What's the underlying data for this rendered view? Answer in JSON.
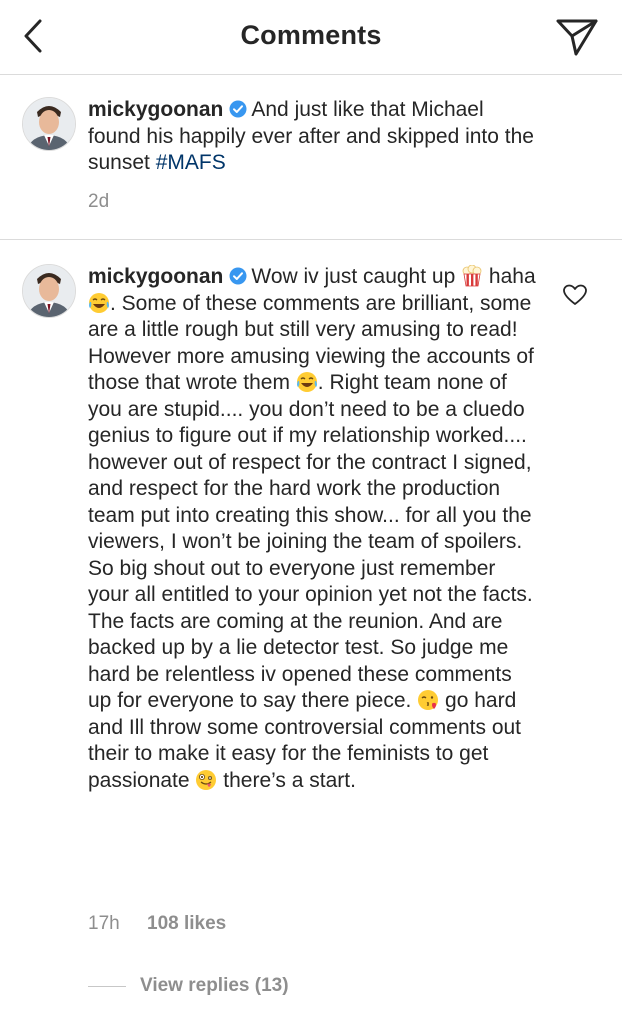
{
  "header": {
    "title": "Comments",
    "back_icon": "chevron-left-icon",
    "share_icon": "paper-plane-icon"
  },
  "caption": {
    "username": "mickygoonan",
    "text_before_tag": "And just like that Michael found his happily ever after and skipped into the sunset ",
    "hashtag": "#MAFS",
    "time": "2d"
  },
  "comment": {
    "username": "mickygoonan",
    "part1": "Wow iv just caught up ",
    "part2": " haha ",
    "part3": ". Some of these comments are brilliant, some are a little rough but still very amusing to read! However more amusing viewing the accounts of those that wrote them ",
    "part4": ". Right team none of you are stupid.... you don’t need to be a cluedo genius to figure out if my relationship worked.... however out of respect for the contract I signed, and respect for the hard work the production team put into creating this show... for all you the viewers, I won’t be joining the team of spoilers. So big shout out to everyone just remember your all entitled to your opinion yet not the facts. The facts are coming at the reunion. And are backed up by a lie detector test. So judge me hard be relentless iv opened these comments up for everyone to say there piece. ",
    "part5": " go hard and Ill throw some controversial comments out their to make it easy for the feminists to get passionate ",
    "part6": " there’s a start.",
    "time": "17h",
    "likes": "108 likes",
    "replies": "View replies (13)",
    "emojis": [
      "popcorn-emoji",
      "tears-of-joy-emoji",
      "tears-of-joy-emoji",
      "kissing-heart-emoji",
      "zany-face-emoji"
    ]
  },
  "colors": {
    "text": "#262626",
    "secondary": "#8e8e8e",
    "hashtag": "#003569",
    "verified": "#3897f0",
    "divider": "#dbdbdb"
  }
}
